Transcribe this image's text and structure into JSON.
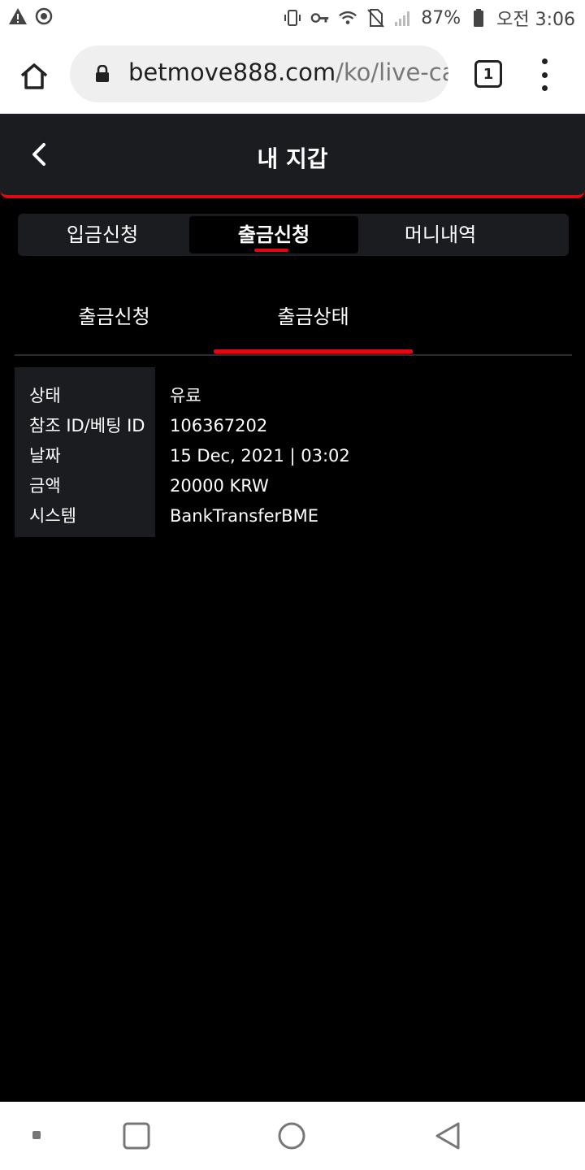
{
  "status_bar": {
    "battery": "87%",
    "time": "오전 3:06"
  },
  "browser": {
    "url_main": "betmove888.com",
    "url_path": "/ko/live-ca",
    "tab_count": "1"
  },
  "header": {
    "title": "내 지갑"
  },
  "segment_tabs": [
    {
      "label": "입금신청",
      "active": false
    },
    {
      "label": "출금신청",
      "active": true
    },
    {
      "label": "머니내역",
      "active": false
    }
  ],
  "sub_tabs": [
    {
      "label": "출금신청",
      "active": false
    },
    {
      "label": "출금상태",
      "active": true
    }
  ],
  "details": [
    {
      "label": "상태",
      "value": "유료"
    },
    {
      "label": "참조 ID/베팅 ID",
      "value": "106367202"
    },
    {
      "label": "날짜",
      "value": "15 Dec, 2021 | 03:02"
    },
    {
      "label": "금액",
      "value": "20000 KRW"
    },
    {
      "label": "시스템",
      "value": "BankTransferBME"
    }
  ],
  "colors": {
    "accent": "#e30613",
    "panel": "#1b1c20",
    "background": "#000000"
  }
}
